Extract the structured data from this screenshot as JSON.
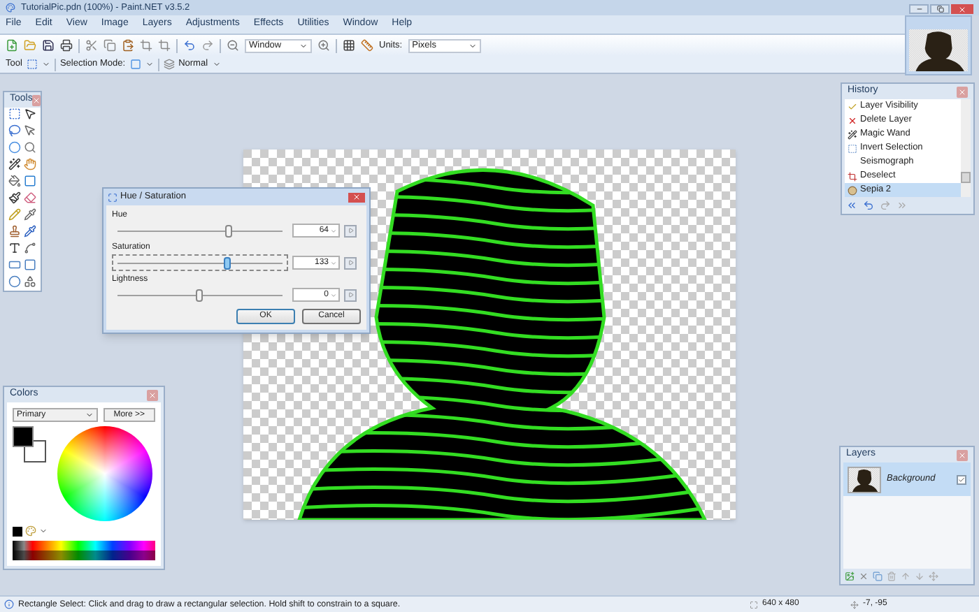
{
  "window": {
    "title": "TutorialPic.pdn (100%) - Paint.NET v3.5.2"
  },
  "menu": [
    "File",
    "Edit",
    "View",
    "Image",
    "Layers",
    "Adjustments",
    "Effects",
    "Utilities",
    "Window",
    "Help"
  ],
  "toolbar": {
    "zoom": "Window",
    "units_label": "Units:",
    "units": "Pixels"
  },
  "tool_bar": {
    "tool_label": "Tool",
    "selection_mode_label": "Selection Mode:",
    "blend_mode": "Normal"
  },
  "tools_panel": {
    "title": "Tools"
  },
  "dialog": {
    "title": "Hue / Saturation",
    "sliders": [
      {
        "label": "Hue",
        "level": 0.67,
        "value": "64",
        "focused": false
      },
      {
        "label": "Saturation",
        "level": 0.66,
        "value": "133",
        "focused": true
      },
      {
        "label": "Lightness",
        "level": 0.5,
        "value": "0",
        "focused": false
      }
    ],
    "buttons": [
      {
        "label": "OK",
        "default": true
      },
      {
        "label": "Cancel",
        "default": false
      }
    ]
  },
  "history": {
    "title": "History",
    "items": [
      {
        "label": "Layer Visibility",
        "selected": false
      },
      {
        "label": "Delete Layer",
        "selected": false
      },
      {
        "label": "Magic Wand",
        "selected": false
      },
      {
        "label": "Invert Selection",
        "selected": false
      },
      {
        "label": "Seismograph",
        "selected": false
      },
      {
        "label": "Deselect",
        "selected": false
      },
      {
        "label": "Sepia 2",
        "selected": true
      }
    ]
  },
  "colors": {
    "title": "Colors",
    "mode": "Primary",
    "more": "More >>"
  },
  "layers": {
    "title": "Layers",
    "items": [
      {
        "name": "Background",
        "visible": true,
        "selected": true
      }
    ]
  },
  "status_bar": {
    "text": "Rectangle Select: Click and drag to draw a rectangular selection. Hold shift to constrain to a square.",
    "size": "640 x 480",
    "position": "-7, -95"
  }
}
